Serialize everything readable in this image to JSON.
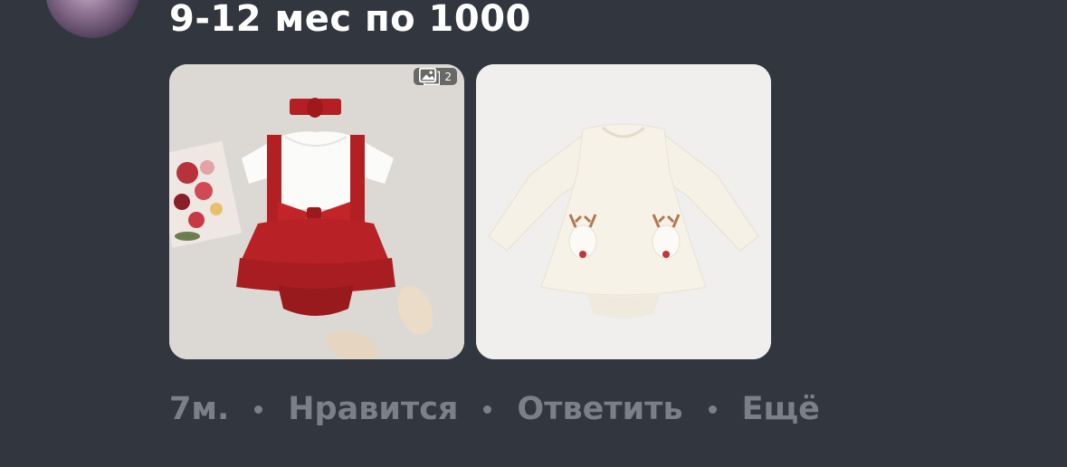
{
  "comment": {
    "text": "9-12 мес по 1000"
  },
  "attachments": {
    "photo_count": "2",
    "photos": [
      {
        "icon": "red-dress-photo"
      },
      {
        "icon": "reindeer-bodysuit-photo"
      }
    ]
  },
  "actions": {
    "time": "7м.",
    "like": "Нравится",
    "reply": "Ответить",
    "more": "Ещё"
  },
  "colors": {
    "background": "#32373f",
    "text": "#ffffff",
    "muted": "#7a8089"
  }
}
